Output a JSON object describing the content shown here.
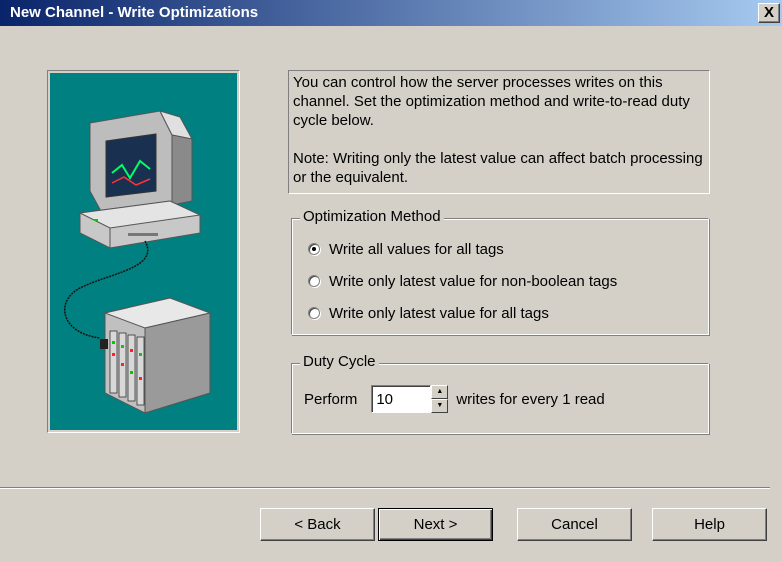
{
  "window": {
    "title": "New Channel - Write Optimizations",
    "close_label": "X"
  },
  "info": {
    "description": "You can control how the server processes writes on this channel.  Set the optimization method and write-to-read duty cycle below.",
    "note": "Note:  Writing only the latest value can affect batch processing or the equivalent."
  },
  "optimization": {
    "label": "Optimization Method",
    "options": [
      {
        "label": "Write all values for all tags",
        "selected": true
      },
      {
        "label": "Write only latest value for non-boolean tags",
        "selected": false
      },
      {
        "label": "Write only latest value for all tags",
        "selected": false
      }
    ]
  },
  "duty_cycle": {
    "label": "Duty Cycle",
    "prefix": "Perform",
    "value": "10",
    "suffix": "writes for every 1 read"
  },
  "buttons": {
    "back": "< Back",
    "next": "Next >",
    "cancel": "Cancel",
    "help": "Help"
  },
  "colors": {
    "title_bar": "#0a246a",
    "dialog_bg": "#d4d0c8",
    "illustration_bg": "#008080"
  },
  "icons": {
    "illustration": "computer-connected-to-device-illustration"
  }
}
